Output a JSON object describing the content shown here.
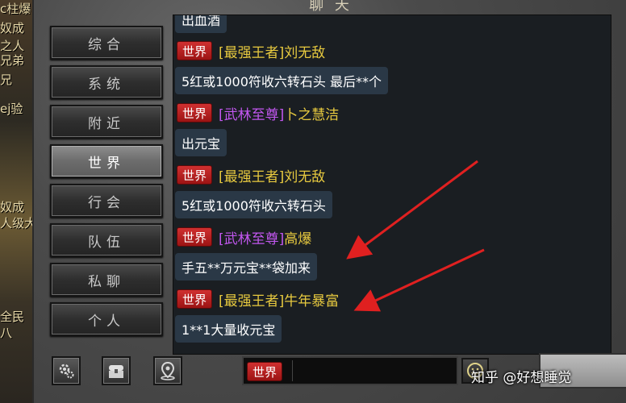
{
  "window": {
    "title": "聊 天"
  },
  "left_background": {
    "fragments": [
      "c柱爆",
      "奴成",
      "之人",
      "兄弟",
      "兄",
      "ej验",
      "奴成",
      "人级大",
      "全民",
      "八"
    ]
  },
  "tabs": [
    {
      "label": "综合",
      "active": false
    },
    {
      "label": "系统",
      "active": false
    },
    {
      "label": "附近",
      "active": false
    },
    {
      "label": "世界",
      "active": true
    },
    {
      "label": "行会",
      "active": false
    },
    {
      "label": "队伍",
      "active": false
    },
    {
      "label": "私聊",
      "active": false
    },
    {
      "label": "个人",
      "active": false
    }
  ],
  "chat": {
    "top_partial": "出血酒",
    "messages": [
      {
        "channel": "世界",
        "title": "[最强王者]",
        "name": "刘无敌",
        "title_color": "gold",
        "text": "5红或1000符收六转石头 最后**个"
      },
      {
        "channel": "世界",
        "title": "[武林至尊]",
        "name": "卜之慧洁",
        "title_color": "purple",
        "text": "出元宝"
      },
      {
        "channel": "世界",
        "title": "[最强王者]",
        "name": "刘无敌",
        "title_color": "gold",
        "text": "5红或1000符收六转石头"
      },
      {
        "channel": "世界",
        "title": "[武林至尊]",
        "name": "高爆",
        "title_color": "purple",
        "text": "手五**万元宝**袋加来"
      },
      {
        "channel": "世界",
        "title": "[最强王者]",
        "name": "牛年暴富",
        "title_color": "gold",
        "text": "1**1大量收元宝"
      }
    ]
  },
  "bottom": {
    "settings_icon": "gear-icon",
    "chest_icon": "chest-icon",
    "location_icon": "location-pin-icon",
    "input_channel": "世界",
    "emoji_icon": "smiley-icon"
  },
  "watermark": {
    "text": "知乎 @好想睡觉",
    "icon_text": "知"
  },
  "colors": {
    "badge_red": "#c02020",
    "gold_title": "#e7c93f",
    "purple_title": "#c257f0",
    "message_bg": "#2a3846",
    "arrow_red": "#e02020"
  }
}
